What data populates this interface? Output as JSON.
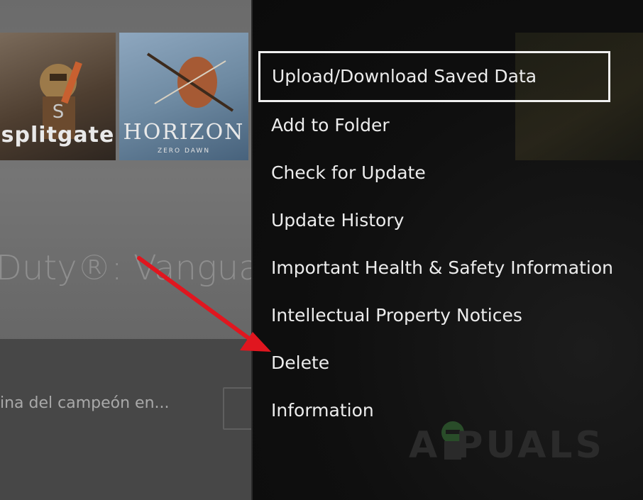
{
  "background": {
    "tiles": [
      {
        "name": "splitgate",
        "label": "splitgate"
      },
      {
        "name": "horizon",
        "label": "HORIZON",
        "sublabel": "ZERO DAWN"
      }
    ],
    "game_title": "Duty®: Vanguar",
    "news_text": "ina del campeón en..."
  },
  "menu": {
    "items": [
      {
        "label": "Upload/Download Saved Data",
        "selected": true
      },
      {
        "label": "Add to Folder"
      },
      {
        "label": "Check for Update"
      },
      {
        "label": "Update History"
      },
      {
        "label": "Important Health & Safety Information"
      },
      {
        "label": "Intellectual Property Notices"
      },
      {
        "label": "Delete"
      },
      {
        "label": "Information"
      }
    ]
  },
  "annotation": {
    "arrow_color": "#e0161f",
    "target": "Delete"
  },
  "watermark": {
    "text": "A PUALS"
  }
}
